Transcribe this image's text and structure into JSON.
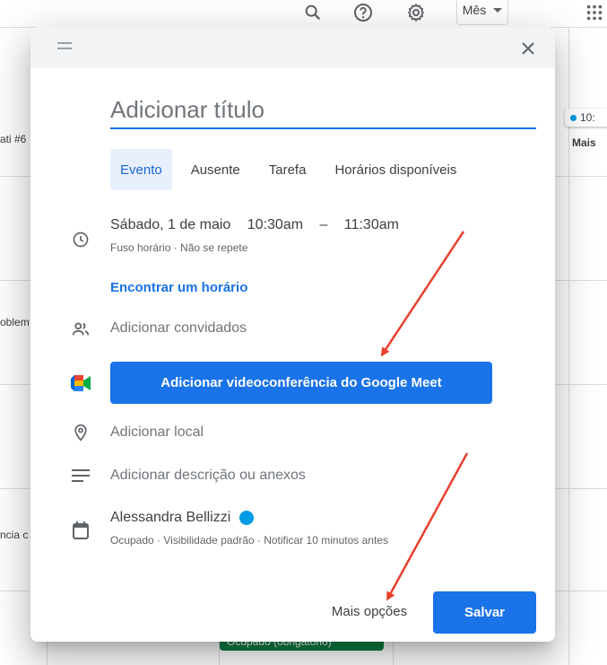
{
  "topbar": {
    "icons": [
      "search-icon",
      "help-icon",
      "settings-icon",
      "apps-grid-icon"
    ],
    "view_label": "Mês"
  },
  "background": {
    "left_texts": [
      "ati #6",
      "oblem",
      "ncia c"
    ],
    "chip_time": "10:",
    "more_label": "Mais",
    "green_chip": "Ocupado (obrigatório)"
  },
  "dialog": {
    "title_placeholder": "Adicionar título",
    "tabs": [
      {
        "label": "Evento",
        "active": true
      },
      {
        "label": "Ausente",
        "active": false
      },
      {
        "label": "Tarefa",
        "active": false
      },
      {
        "label": "Horários disponíveis",
        "active": false
      }
    ],
    "date": {
      "day": "Sábado, 1 de maio",
      "start": "10:30am",
      "dash": "–",
      "end": "11:30am",
      "sub": "Fuso horário · Não se repete"
    },
    "find_time": "Encontrar um horário",
    "add_guests": "Adicionar convidados",
    "meet_button": "Adicionar videoconferência do Google Meet",
    "add_location": "Adicionar local",
    "add_description": "Adicionar descrição ou anexos",
    "owner": {
      "name": "Alessandra Bellizzi",
      "color": "#039be5",
      "sub": "Ocupado · Visibilidade padrão · Notificar 10 minutos antes"
    },
    "more_options": "Mais opções",
    "save": "Salvar"
  },
  "colors": {
    "accent": "#1a73e8",
    "tab_active_bg": "#e8f0fe",
    "annotation_arrow": "#e8402e"
  }
}
